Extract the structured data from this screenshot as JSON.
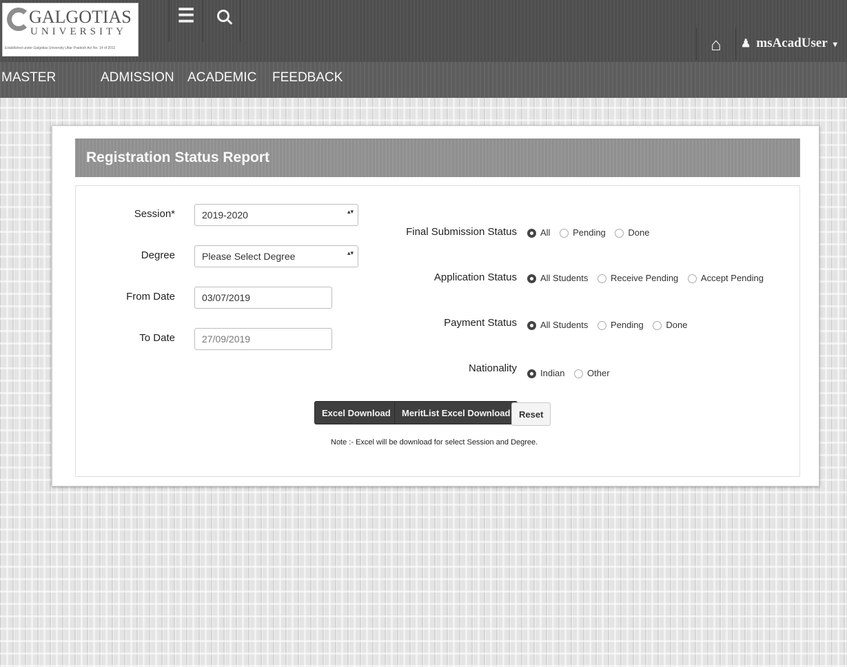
{
  "header": {
    "logo": {
      "name": "GALGOTIAS",
      "sub": "UNIVERSITY",
      "tagline": "Established under Galgotias University Uttar Pradesh Act No. 14 of 2011"
    },
    "menu_icon": "hamburger-icon",
    "search_icon": "search-icon",
    "home_icon": "home-icon",
    "user": {
      "name": "msAcadUser",
      "icon": "user-icon"
    }
  },
  "nav": {
    "items": [
      {
        "label": "MASTER"
      },
      {
        "label": "ADMISSION"
      },
      {
        "label": "ACADEMIC"
      },
      {
        "label": "FEEDBACK"
      }
    ]
  },
  "panel": {
    "title": "Registration Status Report",
    "session": {
      "label": "Session*",
      "value": "2019-2020"
    },
    "degree": {
      "label": "Degree",
      "value": "Please Select Degree"
    },
    "from_date": {
      "label": "From Date",
      "value": "03/07/2019"
    },
    "to_date": {
      "label": "To Date",
      "value": "27/09/2019"
    },
    "final_submission": {
      "label": "Final Submission Status",
      "options": [
        "All",
        "Pending",
        "Done"
      ],
      "selected": "All"
    },
    "application_status": {
      "label": "Application Status",
      "options": [
        "All Students",
        "Receive Pending",
        "Accept Pending"
      ],
      "selected": "All Students"
    },
    "payment_status": {
      "label": "Payment Status",
      "options": [
        "All Students",
        "Pending",
        "Done"
      ],
      "selected": "All Students"
    },
    "nationality": {
      "label": "Nationality",
      "options": [
        "Indian",
        "Other"
      ],
      "selected": "Indian"
    },
    "buttons": {
      "excel": "Excel Download",
      "merit": "MeritList Excel Download",
      "reset": "Reset"
    },
    "note": "Note :- Excel will be download for select Session and Degree."
  },
  "colors": {
    "topbar": "#4e4e4e",
    "navbar": "#5d5d5d",
    "panel_header": "#8f8f8f",
    "button_dark": "#3f3f3f"
  }
}
